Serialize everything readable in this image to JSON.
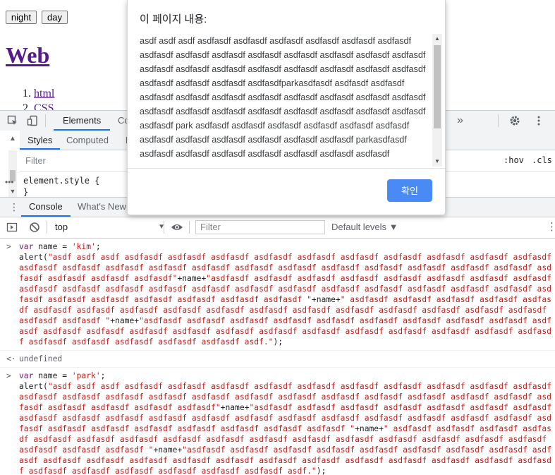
{
  "page": {
    "night_label": "night",
    "day_label": "day",
    "title": "Web",
    "links": [
      "html",
      "CSS"
    ]
  },
  "devtools": {
    "tabs": {
      "elements": "Elements",
      "console_cut": "Co",
      "more": "»"
    },
    "styles_tabs": {
      "styles": "Styles",
      "computed": "Computed",
      "cut": "E"
    },
    "filter_placeholder": "Filter",
    "hov": ":hov",
    "cls": ".cls",
    "plus": "+",
    "element_style": "element.style {\n}",
    "drawer_tabs": {
      "console": "Console",
      "whats_new": "What's New"
    },
    "context": "top",
    "console_filter_placeholder": "Filter",
    "levels": "Default levels ▼"
  },
  "console": {
    "entries": [
      {
        "type": "input",
        "line1_kw": "var",
        "line1_rest": " name = ",
        "line1_str": "'kim'",
        "line1_end": ";",
        "alert_open": "alert(",
        "alert_str_1": "\"asdf asdf asdf asdfasdf asdfasdf asdfasdf asdfasdf asdfasdf asdfasdf asdfasdf asdfasdf asdfasdf asdfasdf asdfasdf asdfasdf asdfasdf asdfasdf asdfasdf asdfasdf asdfasdf asdfasdf asdfasdf asdfasdf asdfasdf asdfasdf asdfasdf asdfasdf asdfasdf asdfasdf\"",
        "alert_mid_1": "+name+",
        "alert_str_2": "\"asdfasdf asdfasdf asdfasdf asdfasdf asdfasdf asdfasdf asdfasdf asdfasdf asdfasdf asdfasdf asdfasdf asdfasdf asdfasdf asdfasdf asdfasdf asdfasdf asdfasdf asdfasdf asdfasdf asdfasdf asdfasdf asdfasdf asdfasdf asdfasdf asdfasdf asdfasdf asdfasdf \"",
        "alert_mid_2": "+name+",
        "alert_str_3": "\" asdfasdf asdfasdf asdfasdf asdfasdf asdfasdf asdfasdf asdfasdf asdfasdf asdfasdf asdfasdf asdfasdf asdfasdf asdfasdf asdfasdf asdfasdf asdfasdf asdfasdf asdfasdf asdfasdf \"",
        "alert_mid_3": "+name+",
        "alert_str_4": "\"asdfasdf asdfasdf asdfasdf asdfasdf asdfasdf asdfasdf asdfasdf asdfasdf asdfasdf asdfasdf asdfasdf asdfasdf asdfasdf asdfasdf asdfasdf asdfasdf asdfasdf asdfasdf asdfasdf asdfasdf asdfasdf asdfasdf asdfasdf asdfasdf asdfasdf asdfasdf asdfasdf asdf.\"",
        "alert_close": ");"
      },
      {
        "type": "result",
        "text": "undefined"
      },
      {
        "type": "input",
        "line1_kw": "var",
        "line1_rest": " name = ",
        "line1_str": "'park'",
        "line1_end": ";",
        "alert_open": "alert(",
        "alert_str_1": "\"asdf asdf asdf asdfasdf asdfasdf asdfasdf asdfasdf asdfasdf asdfasdf asdfasdf asdfasdf asdfasdf asdfasdf asdfasdf asdfasdf asdfasdf asdfasdf asdfasdf asdfasdf asdfasdf asdfasdf asdfasdf asdfasdf asdfasdf asdfasdf asdfasdf asdfasdf asdfasdf asdfasdf asdfasdf\"",
        "alert_mid_1": "+name+",
        "alert_str_2": "\"asdfasdf asdfasdf asdfasdf asdfasdf asdfasdf asdfasdf asdfasdf asdfasdf asdfasdf asdfasdf asdfasdf asdfasdf asdfasdf asdfasdf asdfasdf asdfasdf asdfasdf asdfasdf asdfasdf asdfasdf asdfasdf asdfasdf asdfasdf asdfasdf asdfasdf asdfasdf asdfasdf \"",
        "alert_mid_2": "+name+",
        "alert_str_3": "\" asdfasdf asdfasdf asdfasdf asdfasdf asdfasdf asdfasdf asdfasdf asdfasdf asdfasdf asdfasdf asdfasdf asdfasdf asdfasdf asdfasdf asdfasdf asdfasdf asdfasdf asdfasdf asdfasdf \"",
        "alert_mid_3": "+name+",
        "alert_str_4": "\"asdfasdf asdfasdf asdfasdf asdfasdf asdfasdf asdfasdf asdfasdf asdfasdf asdfasdf asdfasdf asdfasdf asdfasdf asdfasdf asdfasdf asdfasdf asdfasdf asdfasdf asdfasdf asdfasdf asdfasdf asdfasdf asdfasdf asdfasdf asdfasdf asdfasdf asdfasdf asdfasdf asdf.\"",
        "alert_close": ");"
      }
    ],
    "input_marker": ">",
    "result_marker": "<·"
  },
  "dialog": {
    "title": "이 페이지 내용:",
    "message": "asdf asdf asdf asdfasdf asdfasdf asdfasdf asdfasdf asdfasdf asdfasdf asdfasdf asdfasdf asdfasdf asdfasdf asdfasdf asdfasdf asdfasdf asdfasdf asdfasdf asdfasdf asdfasdf asdfasdf asdfasdf asdfasdf asdfasdf asdfasdf asdfasdf asdfasdf asdfasdf asdfasdfparkasdfasdf asdfasdf asdfasdf asdfasdf asdfasdf asdfasdf asdfasdf asdfasdf asdfasdf asdfasdf asdfasdf asdfasdf asdfasdf asdfasdf asdfasdf asdfasdf asdfasdf asdfasdf asdfasdf asdfasdf park asdfasdf asdfasdf asdfasdf asdfasdf asdfasdf asdfasdf asdfasdf asdfasdf asdfasdf asdfasdf asdfasdf asdfasdf parkasdfasdf asdfasdf asdfasdf asdfasdf asdfasdf asdfasdf asdfasdf asdfasdf",
    "ok_label": "확인",
    "accent_color": "#4a8af4"
  }
}
